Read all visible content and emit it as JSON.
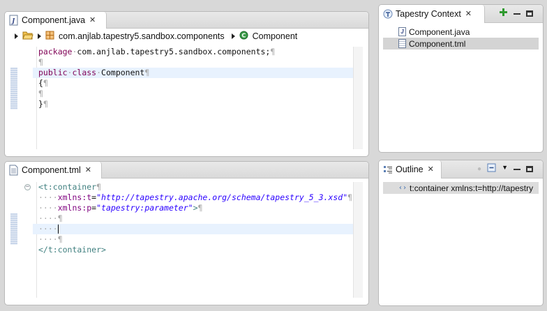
{
  "editor_java": {
    "tab_label": "Component.java",
    "breadcrumb": {
      "package": "com.anjlab.tapestry5.sandbox.components",
      "class": "Component"
    },
    "lines": [
      {
        "parts": [
          {
            "t": "package",
            "c": "kw"
          },
          {
            "t": "·",
            "c": "dim"
          },
          {
            "t": "com.anjlab.tapestry5.sandbox.components;",
            "c": ""
          },
          {
            "t": "¶",
            "c": "dim"
          }
        ]
      },
      {
        "parts": [
          {
            "t": "¶",
            "c": "dim"
          }
        ]
      },
      {
        "parts": [
          {
            "t": "public",
            "c": "kw"
          },
          {
            "t": "·",
            "c": "dim"
          },
          {
            "t": "class",
            "c": "kw"
          },
          {
            "t": "·",
            "c": "dim"
          },
          {
            "t": "Component",
            "c": ""
          },
          {
            "t": "¶",
            "c": "dim"
          }
        ],
        "hl": true
      },
      {
        "parts": [
          {
            "t": "{",
            "c": ""
          },
          {
            "t": "¶",
            "c": "dim"
          }
        ]
      },
      {
        "parts": [
          {
            "t": "¶",
            "c": "dim"
          }
        ]
      },
      {
        "parts": [
          {
            "t": "}",
            "c": ""
          },
          {
            "t": "¶",
            "c": "dim"
          }
        ]
      }
    ]
  },
  "editor_tml": {
    "tab_label": "Component.tml",
    "lines": [
      {
        "parts": [
          {
            "t": "<t:container",
            "c": "tag"
          },
          {
            "t": "¶",
            "c": "dim"
          }
        ],
        "fold": "−"
      },
      {
        "parts": [
          {
            "t": "····",
            "c": "dim"
          },
          {
            "t": "xmlns:t",
            "c": "attr"
          },
          {
            "t": "=",
            "c": ""
          },
          {
            "t": "\"http://tapestry.apache.org/schema/tapestry_5_3.xsd\"",
            "c": "str"
          },
          {
            "t": "¶",
            "c": "dim"
          }
        ]
      },
      {
        "parts": [
          {
            "t": "····",
            "c": "dim"
          },
          {
            "t": "xmlns:p",
            "c": "attr"
          },
          {
            "t": "=",
            "c": ""
          },
          {
            "t": "\"tapestry:parameter\"",
            "c": "str"
          },
          {
            "t": ">",
            "c": "tag"
          },
          {
            "t": "¶",
            "c": "dim"
          }
        ]
      },
      {
        "parts": [
          {
            "t": "····",
            "c": "dim"
          },
          {
            "t": "¶",
            "c": "dim"
          }
        ]
      },
      {
        "parts": [
          {
            "t": "····",
            "c": "dim"
          }
        ],
        "hl": true,
        "caret": true
      },
      {
        "parts": [
          {
            "t": "····",
            "c": "dim"
          },
          {
            "t": "¶",
            "c": "dim"
          }
        ]
      },
      {
        "parts": [
          {
            "t": "</t:container>",
            "c": "tag"
          }
        ]
      }
    ]
  },
  "tapestry_view": {
    "tab_label": "Tapestry Context",
    "items": [
      {
        "label": "Component.java",
        "icon": "java-file-icon",
        "selected": false
      },
      {
        "label": "Component.tml",
        "icon": "tml-file-icon",
        "selected": true
      }
    ]
  },
  "outline_view": {
    "tab_label": "Outline",
    "items": [
      {
        "label": "t:container xmlns:t=http://tapestry"
      }
    ]
  },
  "colors": {
    "keyword": "#7f0055",
    "tag": "#3f7f7f",
    "attribute": "#7f007f",
    "string": "#2a00ff",
    "line_highlight": "#e8f2fe",
    "selection": "#d4d4d4"
  }
}
